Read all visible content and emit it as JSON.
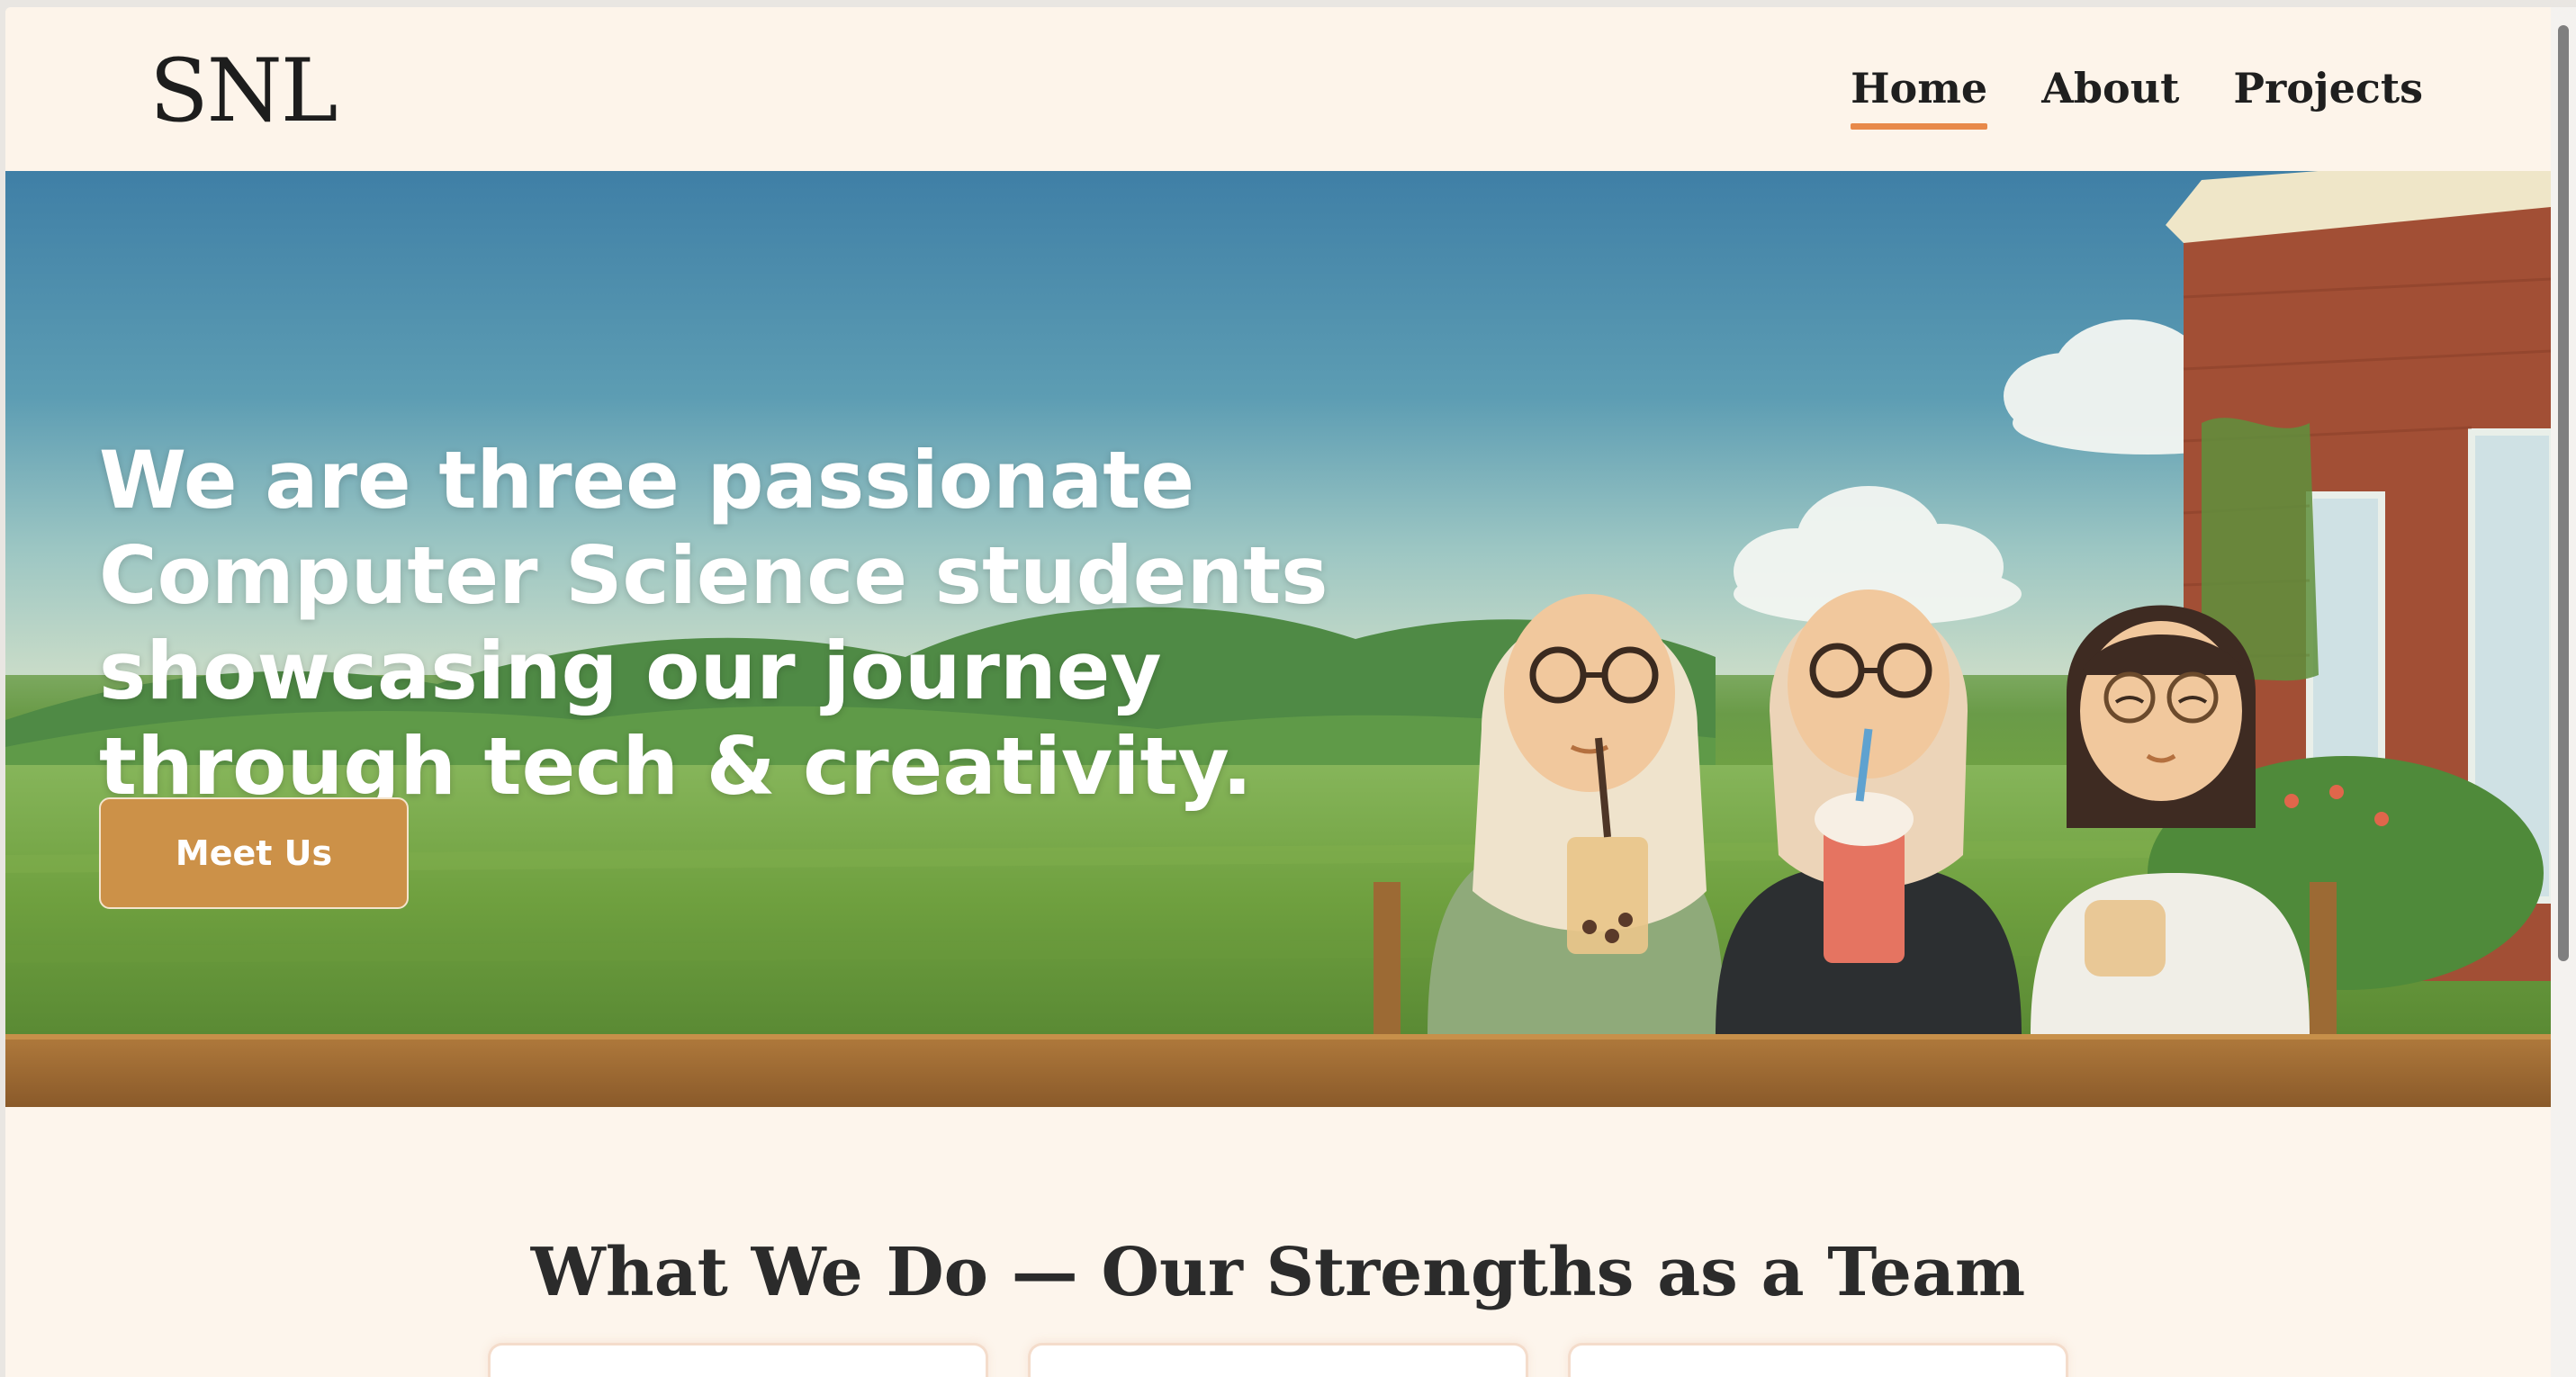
{
  "brand": {
    "logo": "SNL"
  },
  "nav": {
    "items": [
      {
        "label": "Home",
        "active": true
      },
      {
        "label": "About",
        "active": false
      },
      {
        "label": "Projects",
        "active": false
      }
    ]
  },
  "hero": {
    "headline": "We are three passionate Computer Science students showcasing our journey through tech & creativity.",
    "cta_label": "Meet Us"
  },
  "section": {
    "title": "What We Do — Our Strengths as a Team"
  },
  "colors": {
    "accent": "#e8894a",
    "button": "#cc9148",
    "background": "#fdf5ec"
  }
}
